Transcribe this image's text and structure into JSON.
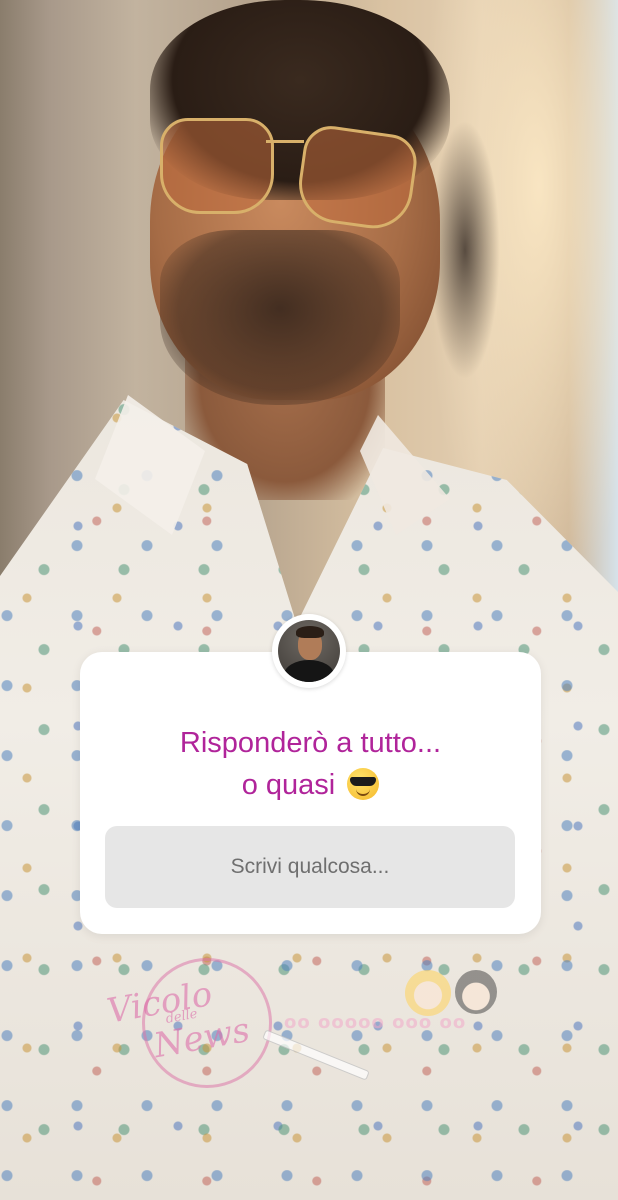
{
  "story": {
    "question_sticker": {
      "question_line1": "Risponderò a tutto...",
      "question_line2": "o quasi",
      "question_emoji": "smiling-face-with-sunglasses",
      "answer_placeholder": "Scrivi qualcosa...",
      "text_color": "#b0249a"
    },
    "watermark": {
      "script_top": "Vicolo",
      "script_middle": "delle",
      "script_bottom": "News",
      "dots_text": "oo ooooo ooo oo"
    }
  }
}
